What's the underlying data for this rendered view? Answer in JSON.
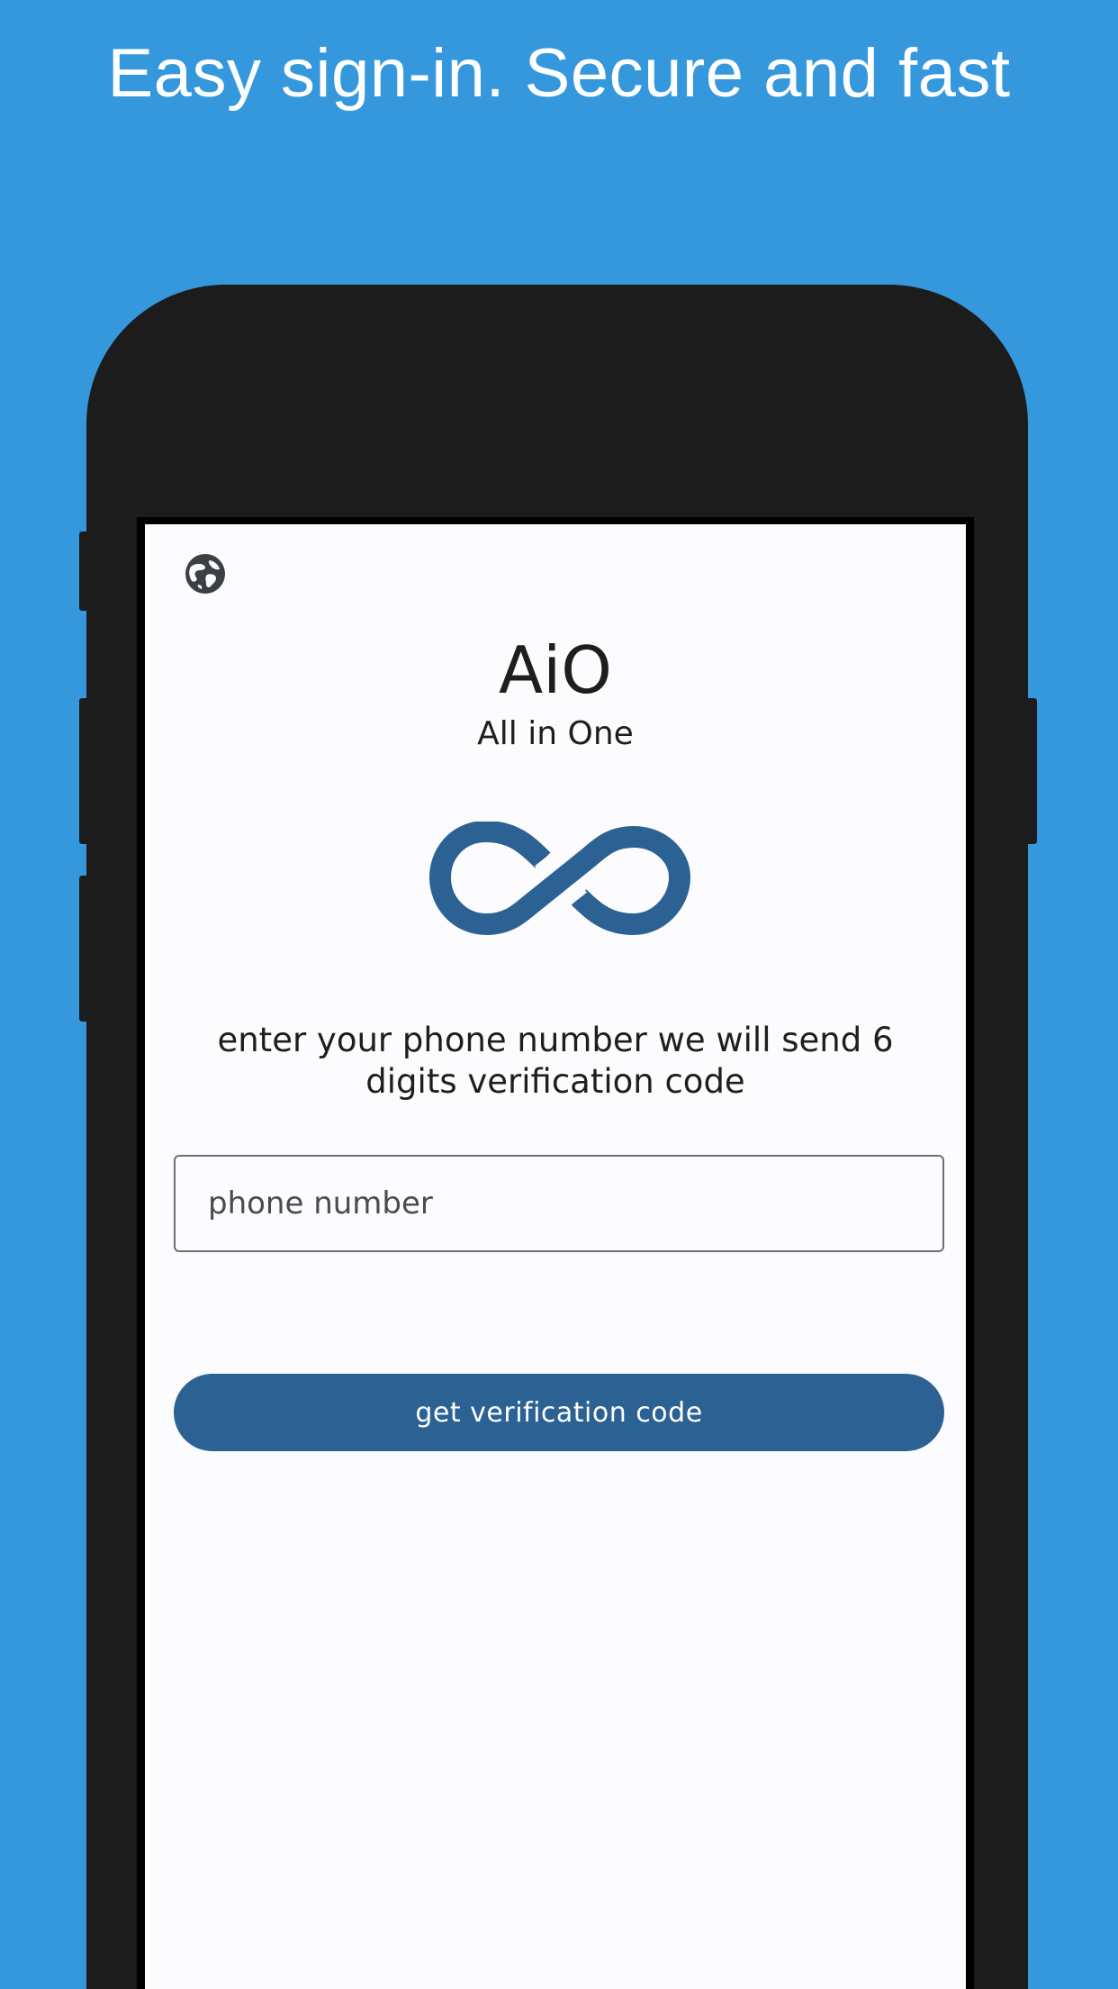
{
  "headline": "Easy sign-in. Secure and fast",
  "app": {
    "title": "AiO",
    "subtitle": "All in One"
  },
  "icons": {
    "language": "globe-icon",
    "logo": "infinity-logo"
  },
  "instruction": "enter your phone number we will send 6 digits verification code",
  "phone_input": {
    "value": "",
    "placeholder": "phone number"
  },
  "submit_button": {
    "label": "get verification code"
  },
  "colors": {
    "background": "#3698dc",
    "device": "#1c1c1c",
    "screen": "#fcfcff",
    "accent": "#2b6193",
    "text": "#1e1e1e"
  }
}
